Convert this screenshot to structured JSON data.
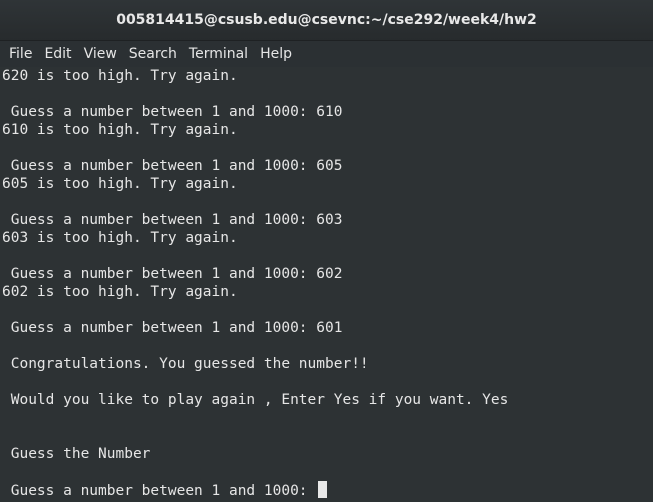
{
  "window": {
    "title": "005814415@csusb.edu@csevnc:~/cse292/week4/hw2"
  },
  "menu": {
    "items": [
      "File",
      "Edit",
      "View",
      "Search",
      "Terminal",
      "Help"
    ]
  },
  "terminal": {
    "lines": [
      "620 is too high. Try again.",
      "",
      " Guess a number between 1 and 1000: 610",
      "610 is too high. Try again.",
      "",
      " Guess a number between 1 and 1000: 605",
      "605 is too high. Try again.",
      "",
      " Guess a number between 1 and 1000: 603",
      "603 is too high. Try again.",
      "",
      " Guess a number between 1 and 1000: 602",
      "602 is too high. Try again.",
      "",
      " Guess a number between 1 and 1000: 601",
      "",
      " Congratulations. You guessed the number!!",
      "",
      " Would you like to play again , Enter Yes if you want. Yes",
      "",
      "",
      " Guess the Number",
      "",
      " Guess a number between 1 and 1000: "
    ]
  }
}
